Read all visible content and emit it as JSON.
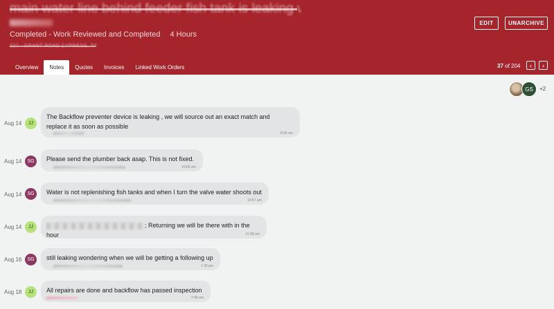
{
  "header": {
    "title": "main water line behind feeder fish tank is leaking water",
    "status": "Completed - Work Reviewed and Completed",
    "duration": "4 Hours",
    "address": "227 - GRANT ROAD CYPRESS, TX",
    "edit_label": "EDIT",
    "unarchive_label": "UNARCHIVE"
  },
  "tabs": [
    {
      "label": "Overview"
    },
    {
      "label": "Notes",
      "active": true
    },
    {
      "label": "Quotes"
    },
    {
      "label": "Invoices"
    },
    {
      "label": "Linked Work Orders"
    }
  ],
  "pager": {
    "current": "37",
    "of_total": "of 204"
  },
  "participants": {
    "avatar2": "GS",
    "more": "+2"
  },
  "messages": [
    {
      "date": "Aug 14",
      "initials": "JJ",
      "text1": "The Backflow preventer device is leaking , we will source out an exact match and",
      "text2": "replace it as soon as possible",
      "time": "8:06 am"
    },
    {
      "date": "Aug 14",
      "initials": "SG",
      "text1": "Please send the plumber back asap. This is not fixed.",
      "time": "10:06 am"
    },
    {
      "date": "Aug 14",
      "initials": "SG",
      "text1": "Water is not replenishing fish tanks and when I turn the valve water shoots out",
      "time": "10:57 am"
    },
    {
      "date": "Aug 14",
      "initials": "JJ",
      "text1": "; Returning we will be there with in the hour",
      "time": "11:08 am"
    },
    {
      "date": "Aug 16",
      "initials": "SG",
      "text1": "still leaking wondering when we will be getting a following up",
      "time": "1:39 pm"
    },
    {
      "date": "Aug 18",
      "initials": "JJ",
      "text1": "All repairs are done and backflow has passed inspection",
      "time": "7:48 am"
    }
  ]
}
